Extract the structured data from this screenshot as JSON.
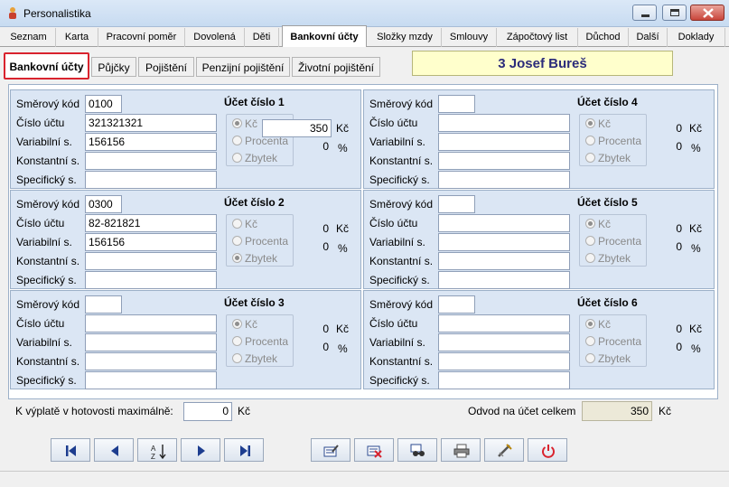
{
  "window": {
    "title": "Personalistika",
    "controls": [
      "minimize-icon",
      "maximize-icon",
      "close-icon"
    ]
  },
  "tabs": [
    {
      "label": "Seznam"
    },
    {
      "label": "Karta"
    },
    {
      "label": "Pracovní poměr"
    },
    {
      "label": "Dovolená"
    },
    {
      "label": "Děti"
    },
    {
      "label": "Bankovní účty",
      "active": true
    },
    {
      "label": "Složky mzdy"
    },
    {
      "label": "Smlouvy"
    },
    {
      "label": "Zápočtový list"
    },
    {
      "label": "Důchod"
    },
    {
      "label": "Další"
    },
    {
      "label": "Doklady"
    }
  ],
  "subtabs": [
    {
      "label": "Bankovní účty",
      "active": true
    },
    {
      "label": "Půjčky"
    },
    {
      "label": "Pojištění"
    },
    {
      "label": "Penzijní pojištění"
    },
    {
      "label": "Životní pojištění"
    }
  ],
  "employee_name": "3 Josef Bureš",
  "labels": {
    "smerovy_kod": "Směrový kód",
    "cislo_uctu": "Číslo účtu",
    "variabilni": "Variabilní s.",
    "konstantni": "Konstantní s.",
    "specificky": "Specifický s.",
    "opt_kc": "Kč",
    "opt_procenta": "Procenta",
    "opt_zbytek": "Zbytek",
    "unit_kc": "Kč",
    "unit_pct": "%"
  },
  "accounts": [
    {
      "title": "Účet číslo 1",
      "bank_code": "0100",
      "account_number": "321321321",
      "variable": "156156",
      "constant": "",
      "specific": "",
      "amount": "350",
      "amount_is_field": true,
      "percent": "0",
      "selected": "kc"
    },
    {
      "title": "Účet číslo 2",
      "bank_code": "0300",
      "account_number": "82-821821",
      "variable": "156156",
      "constant": "",
      "specific": "",
      "amount": "0",
      "amount_is_field": false,
      "percent": "0",
      "selected": "zbytek"
    },
    {
      "title": "Účet číslo 3",
      "bank_code": "",
      "account_number": "",
      "variable": "",
      "constant": "",
      "specific": "",
      "amount": "0",
      "amount_is_field": false,
      "percent": "0",
      "selected": "kc"
    },
    {
      "title": "Účet číslo 4",
      "bank_code": "",
      "account_number": "",
      "variable": "",
      "constant": "",
      "specific": "",
      "amount": "0",
      "amount_is_field": false,
      "percent": "0",
      "selected": "kc"
    },
    {
      "title": "Účet číslo 5",
      "bank_code": "",
      "account_number": "",
      "variable": "",
      "constant": "",
      "specific": "",
      "amount": "0",
      "amount_is_field": false,
      "percent": "0",
      "selected": "kc"
    },
    {
      "title": "Účet číslo 6",
      "bank_code": "",
      "account_number": "",
      "variable": "",
      "constant": "",
      "specific": "",
      "amount": "0",
      "amount_is_field": false,
      "percent": "0",
      "selected": "kc"
    }
  ],
  "footer": {
    "cash_label": "K výplatě v hotovosti  maximálně:",
    "cash_value": "0",
    "cash_unit": "Kč",
    "total_label": "Odvod na účet celkem",
    "total_value": "350",
    "total_unit": "Kč"
  },
  "toolbar": [
    "first-record-icon",
    "previous-record-icon",
    "sort-icon",
    "next-record-icon",
    "last-record-icon",
    "edit-icon",
    "delete-icon",
    "search-icon",
    "print-icon",
    "tools-icon",
    "power-icon"
  ],
  "colors": {
    "accent_red": "#d9232e",
    "panel_blue": "#dbe6f4",
    "name_bg": "#ffffcc",
    "name_text": "#2b2b7a"
  }
}
